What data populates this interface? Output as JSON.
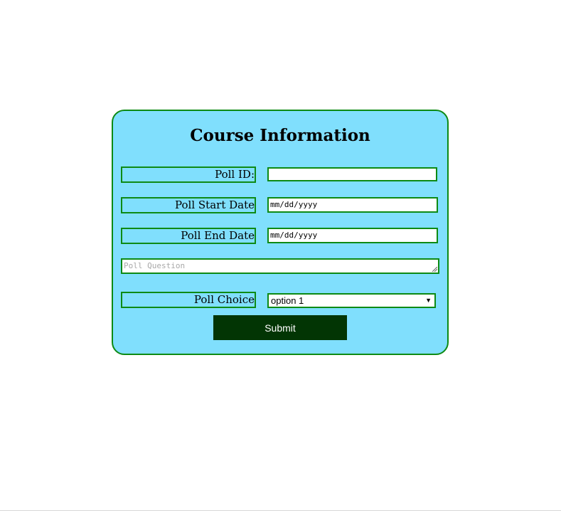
{
  "form": {
    "title": "Course Information",
    "poll_id": {
      "label": "Poll ID:",
      "value": ""
    },
    "poll_start_date": {
      "label": "Poll Start Date",
      "placeholder": "mm/dd/yyyy"
    },
    "poll_end_date": {
      "label": "Poll End Date",
      "placeholder": "mm/dd/yyyy"
    },
    "poll_question": {
      "placeholder": "Poll Question"
    },
    "poll_choice": {
      "label": "Poll Choice",
      "selected": "option 1",
      "arrow": "▼"
    },
    "submit_label": "Submit"
  },
  "colors": {
    "card_background": "#80dffd",
    "border_green": "#0d8a14",
    "submit_background": "#023504",
    "submit_text": "#ffffff"
  }
}
